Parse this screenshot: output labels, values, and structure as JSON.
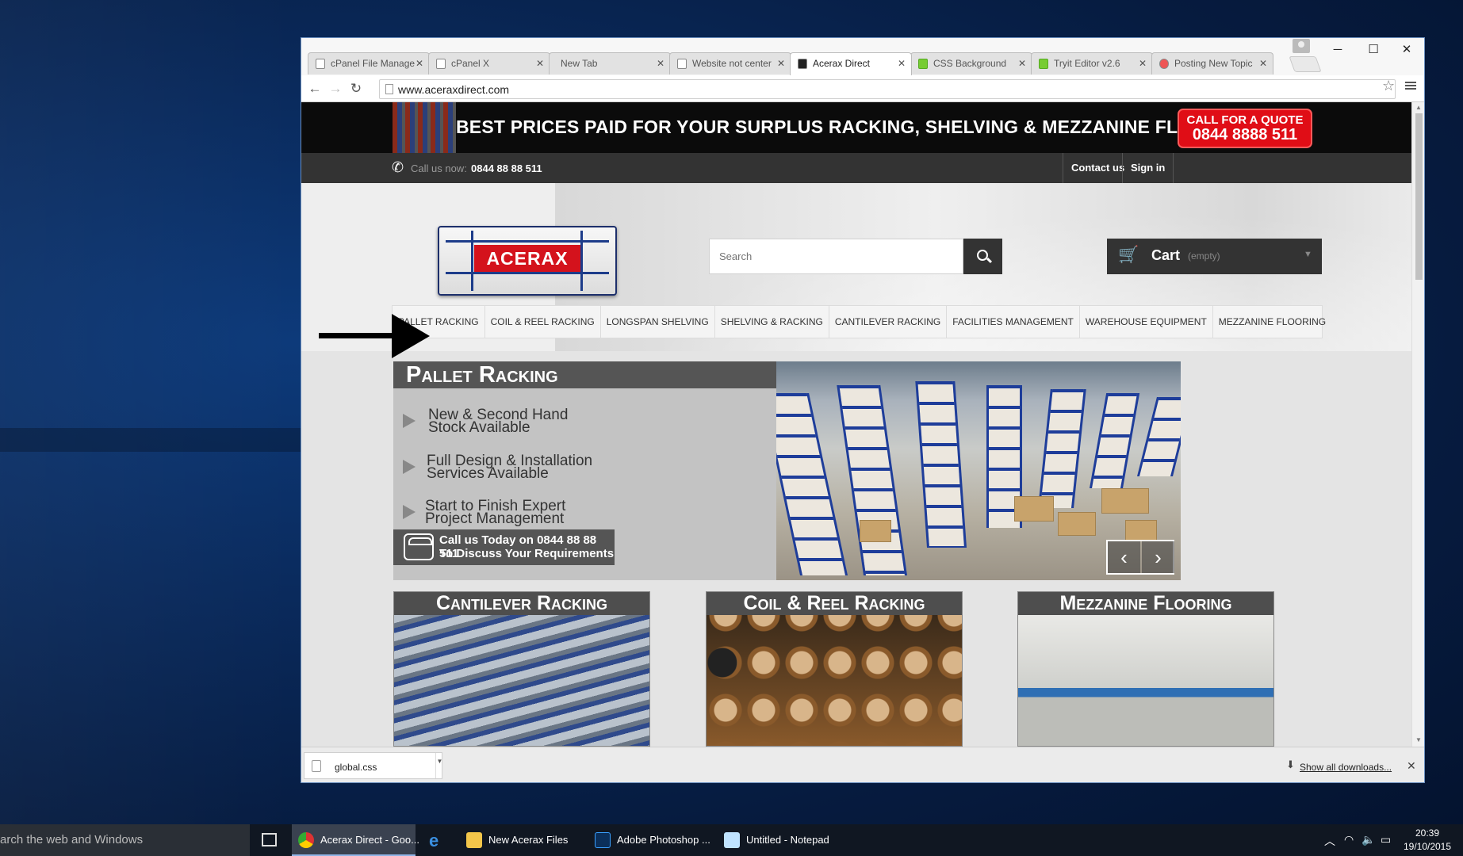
{
  "browser": {
    "tabs": [
      {
        "label": "cPanel File Manage"
      },
      {
        "label": "cPanel X"
      },
      {
        "label": "New Tab"
      },
      {
        "label": "Website not center"
      },
      {
        "label": "Acerax Direct"
      },
      {
        "label": "CSS Background"
      },
      {
        "label": "Tryit Editor v2.6"
      },
      {
        "label": "Posting New Topic"
      }
    ],
    "url": "www.aceraxdirect.com"
  },
  "site": {
    "banner": {
      "message": "BEST PRICES PAID FOR YOUR SURPLUS RACKING, SHELVING & MEZZANINE FLOORS",
      "quote_line1": "CALL FOR A QUOTE",
      "quote_line2": "0844 8888 511"
    },
    "callbar": {
      "label": "Call us now:",
      "phone": "0844 88 88 511",
      "contact": "Contact us",
      "signin": "Sign in"
    },
    "logo_text": "ACERAX",
    "search_placeholder": "Search",
    "cart": {
      "label": "Cart",
      "state": "(empty)"
    },
    "nav": [
      "PALLET RACKING",
      "COIL & REEL RACKING",
      "LONGSPAN SHELVING",
      "SHELVING & RACKING",
      "CANTILEVER RACKING",
      "FACILITIES MANAGEMENT",
      "WAREHOUSE EQUIPMENT",
      "MEZZANINE FLOORING"
    ],
    "slider": {
      "title": "Pallet Racking",
      "features": [
        {
          "l1": "New & Second Hand",
          "l2": "Stock Available"
        },
        {
          "l1": "Full Design & Installation",
          "l2": "Services Available"
        },
        {
          "l1": "Start to Finish Expert",
          "l2": "Project Management"
        }
      ],
      "call_l1": "Call us Today on 0844 88 88 511",
      "call_l2": "To Discuss Your Requirements"
    },
    "categories": [
      "Cantilever Racking",
      "Coil & Reel Racking",
      "Mezzanine Flooring"
    ]
  },
  "downloads": {
    "file": "global.css",
    "show_all": "Show all downloads..."
  },
  "taskbar": {
    "search": "arch the web and Windows",
    "items": [
      "Acerax Direct - Goo...",
      "New Acerax Files",
      "Adobe Photoshop ...",
      "Untitled - Notepad"
    ],
    "time": "20:39",
    "date": "19/10/2015"
  },
  "colors": {
    "banner_red": "#e00d16",
    "dark_bar": "#333333",
    "accent_blue": "#1d3c8a"
  }
}
